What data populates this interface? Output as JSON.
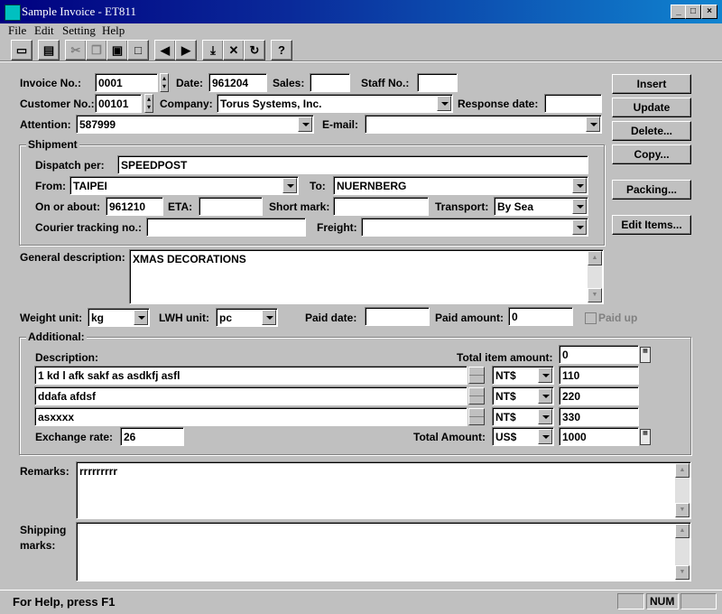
{
  "window": {
    "title": "Sample Invoice - ET811"
  },
  "menu": {
    "items": [
      "File",
      "Edit",
      "Setting",
      "Help"
    ]
  },
  "toolbar": {
    "icons": [
      "open-icon",
      "print-icon",
      "cut-icon",
      "copy-icon",
      "paste-icon",
      "new-icon",
      "prev-icon",
      "next-icon",
      "save-icon",
      "delete-icon",
      "refresh-icon",
      "help-icon"
    ]
  },
  "header": {
    "invoice_no_label": "Invoice No.:",
    "invoice_no": "0001",
    "date_label": "Date:",
    "date": "961204",
    "sales_label": "Sales:",
    "sales": "",
    "staff_no_label": "Staff No.:",
    "staff_no": "",
    "customer_no_label": "Customer No.:",
    "customer_no": "00101",
    "company_label": "Company:",
    "company": "Torus Systems, Inc.",
    "response_date_label": "Response date:",
    "response_date": "",
    "attention_label": "Attention:",
    "attention": "587999",
    "email_label": "E-mail:",
    "email": ""
  },
  "buttons": {
    "insert": "Insert",
    "update": "Update",
    "delete": "Delete...",
    "copy": "Copy...",
    "packing": "Packing...",
    "edit_items": "Edit Items..."
  },
  "shipment": {
    "title": "Shipment",
    "dispatch_label": "Dispatch per:",
    "dispatch": "SPEEDPOST",
    "from_label": "From:",
    "from": "TAIPEI",
    "to_label": "To:",
    "to": "NUERNBERG",
    "on_about_label": "On or about:",
    "on_about": "961210",
    "eta_label": "ETA:",
    "eta": "",
    "short_mark_label": "Short mark:",
    "short_mark": "",
    "transport_label": "Transport:",
    "transport": "By Sea",
    "courier_label": "Courier tracking no.:",
    "courier": "",
    "freight_label": "Freight:",
    "freight": ""
  },
  "general": {
    "label": "General description:",
    "text": "XMAS DECORATIONS"
  },
  "units": {
    "weight_label": "Weight unit:",
    "weight": "kg",
    "lwh_label": "LWH unit:",
    "lwh": "pc",
    "paid_date_label": "Paid date:",
    "paid_date": "",
    "paid_amount_label": "Paid amount:",
    "paid_amount": "0",
    "paid_up_label": "Paid up"
  },
  "additional": {
    "title": "Additional:",
    "description_label": "Description:",
    "total_item_label": "Total item amount:",
    "total_item": "0",
    "items": [
      {
        "desc": "1 kd l afk sakf as asdkfj asfl",
        "currency": "NT$",
        "amount": "110"
      },
      {
        "desc": "ddafa  afdsf",
        "currency": "NT$",
        "amount": "220"
      },
      {
        "desc": "asxxxx",
        "currency": "NT$",
        "amount": "330"
      }
    ],
    "exchange_label": "Exchange rate:",
    "exchange": "26",
    "total_label": "Total Amount:",
    "total_currency": "US$",
    "total": "1000"
  },
  "remarks": {
    "label": "Remarks:",
    "text": "rrrrrrrrr"
  },
  "shipping_marks": {
    "label1": "Shipping",
    "label2": "marks:",
    "text": ""
  },
  "status": {
    "help": "For Help, press F1",
    "num": "NUM"
  }
}
